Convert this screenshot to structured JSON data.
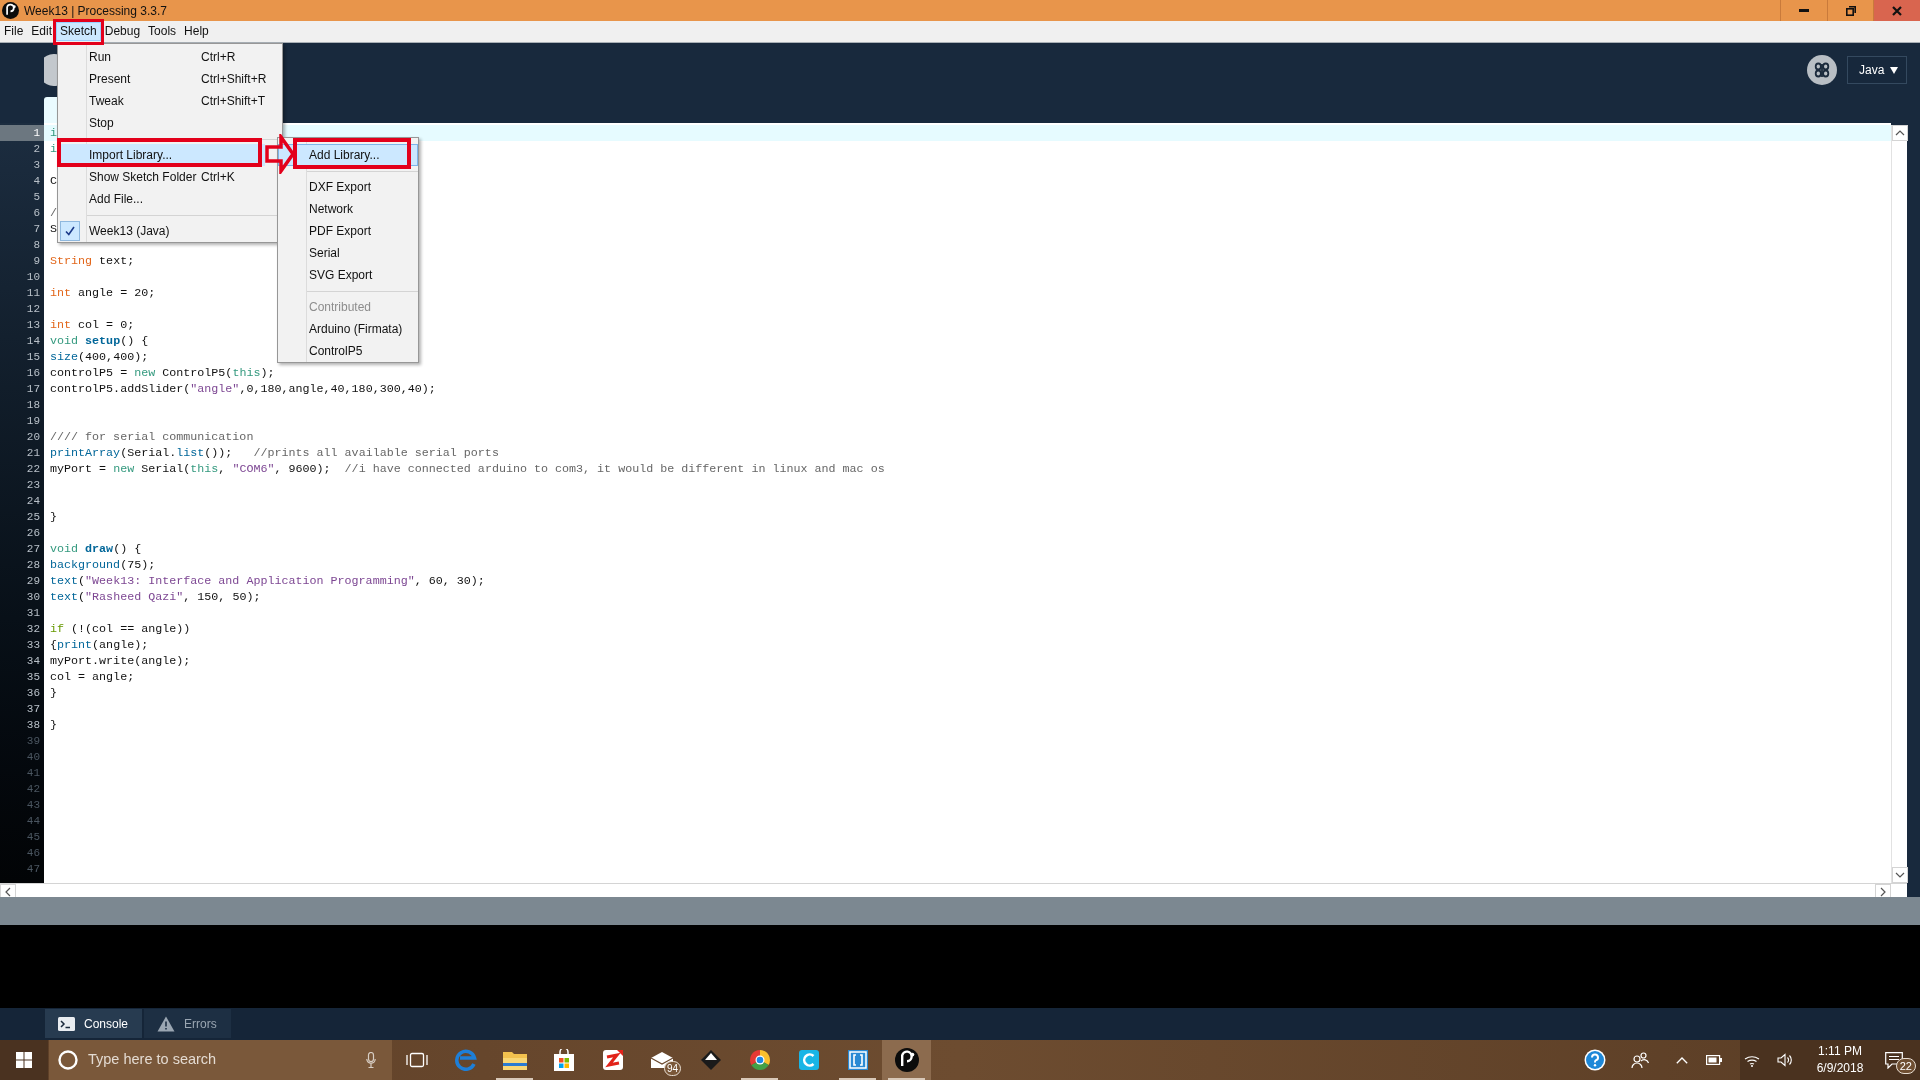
{
  "window": {
    "title": "Week13 | Processing 3.3.7"
  },
  "menu_bar": [
    {
      "label": "File",
      "selected": false,
      "marked": false
    },
    {
      "label": "Edit",
      "selected": false,
      "marked": false
    },
    {
      "label": "Sketch",
      "selected": true,
      "marked": true
    },
    {
      "label": "Debug",
      "selected": false,
      "marked": false
    },
    {
      "label": "Tools",
      "selected": false,
      "marked": false
    },
    {
      "label": "Help",
      "selected": false,
      "marked": false
    }
  ],
  "sketch_menu": [
    {
      "kind": "item",
      "label": "Run",
      "shortcut": "Ctrl+R",
      "selected": false,
      "checked": false,
      "marked": false
    },
    {
      "kind": "item",
      "label": "Present",
      "shortcut": "Ctrl+Shift+R",
      "selected": false,
      "checked": false,
      "marked": false
    },
    {
      "kind": "item",
      "label": "Tweak",
      "shortcut": "Ctrl+Shift+T",
      "selected": false,
      "checked": false,
      "marked": false
    },
    {
      "kind": "item",
      "label": "Stop",
      "selected": false,
      "checked": false,
      "marked": false
    },
    {
      "kind": "separator"
    },
    {
      "kind": "item",
      "label": "Import Library...",
      "selected": true,
      "checked": false,
      "marked": true,
      "submenu": [
        {
          "kind": "item",
          "label": "Add Library...",
          "selected": true,
          "disabled": false,
          "marked": true
        },
        {
          "kind": "separator"
        },
        {
          "kind": "item",
          "label": "DXF Export",
          "selected": false,
          "disabled": false,
          "marked": false
        },
        {
          "kind": "item",
          "label": "Network",
          "selected": false,
          "disabled": false,
          "marked": false
        },
        {
          "kind": "item",
          "label": "PDF Export",
          "selected": false,
          "disabled": false,
          "marked": false
        },
        {
          "kind": "item",
          "label": "Serial",
          "selected": false,
          "disabled": false,
          "marked": false
        },
        {
          "kind": "item",
          "label": "SVG Export",
          "selected": false,
          "disabled": false,
          "marked": false
        },
        {
          "kind": "separator"
        },
        {
          "kind": "item",
          "label": "Contributed",
          "selected": false,
          "disabled": true,
          "marked": false
        },
        {
          "kind": "item",
          "label": "Arduino (Firmata)",
          "selected": false,
          "disabled": false,
          "marked": false
        },
        {
          "kind": "item",
          "label": "ControlP5",
          "selected": false,
          "disabled": false,
          "marked": false
        }
      ]
    },
    {
      "kind": "item",
      "label": "Show Sketch Folder",
      "shortcut": "Ctrl+K",
      "selected": false,
      "checked": false,
      "marked": false
    },
    {
      "kind": "item",
      "label": "Add File...",
      "selected": false,
      "checked": false,
      "marked": false
    },
    {
      "kind": "separator"
    },
    {
      "kind": "item",
      "label": "Week13 (Java)",
      "selected": false,
      "checked": true,
      "marked": false
    }
  ],
  "toolbar": {
    "mode": "Java"
  },
  "editor": {
    "lines": [
      {
        "number": "1",
        "current": true,
        "past_end": false,
        "tokens": [
          {
            "text": "i",
            "kind": "keyword"
          }
        ]
      },
      {
        "number": "2",
        "current": false,
        "past_end": false,
        "tokens": [
          {
            "text": "i",
            "kind": "keyword"
          }
        ]
      },
      {
        "number": "3",
        "current": false,
        "past_end": false
      },
      {
        "number": "4",
        "current": false,
        "past_end": false,
        "tokens": [
          {
            "text": "C",
            "kind": "plain"
          }
        ]
      },
      {
        "number": "5",
        "current": false,
        "past_end": false
      },
      {
        "number": "6",
        "current": false,
        "past_end": false,
        "tokens": [
          {
            "text": "/",
            "kind": "comment"
          }
        ]
      },
      {
        "number": "7",
        "current": false,
        "past_end": false,
        "tokens": [
          {
            "text": "S",
            "kind": "plain"
          }
        ]
      },
      {
        "number": "8",
        "current": false,
        "past_end": false
      },
      {
        "number": "9",
        "current": false,
        "past_end": false,
        "tokens": [
          {
            "text": "String",
            "kind": "type"
          },
          {
            "text": " text;",
            "kind": "plain"
          }
        ]
      },
      {
        "number": "10",
        "current": false,
        "past_end": false
      },
      {
        "number": "11",
        "current": false,
        "past_end": false,
        "tokens": [
          {
            "text": "int",
            "kind": "type"
          },
          {
            "text": " angle = 20;",
            "kind": "plain"
          }
        ]
      },
      {
        "number": "12",
        "current": false,
        "past_end": false
      },
      {
        "number": "13",
        "current": false,
        "past_end": false,
        "tokens": [
          {
            "text": "int",
            "kind": "type"
          },
          {
            "text": " col = 0;",
            "kind": "plain"
          }
        ]
      },
      {
        "number": "14",
        "current": false,
        "past_end": false,
        "tokens": [
          {
            "text": "void ",
            "kind": "keyword"
          },
          {
            "text": "setup",
            "kind": "definition"
          },
          {
            "text": "() {",
            "kind": "plain"
          }
        ]
      },
      {
        "number": "15",
        "current": false,
        "past_end": false,
        "tokens": [
          {
            "text": "size",
            "kind": "function"
          },
          {
            "text": "(400,400);",
            "kind": "plain"
          }
        ]
      },
      {
        "number": "16",
        "current": false,
        "past_end": false,
        "tokens": [
          {
            "text": "controlP5 = ",
            "kind": "plain"
          },
          {
            "text": "new",
            "kind": "keyword"
          },
          {
            "text": " ControlP5(",
            "kind": "plain"
          },
          {
            "text": "this",
            "kind": "keyword"
          },
          {
            "text": ");",
            "kind": "plain"
          }
        ]
      },
      {
        "number": "17",
        "current": false,
        "past_end": false,
        "tokens": [
          {
            "text": "controlP5.addSlider(",
            "kind": "plain"
          },
          {
            "text": "\"angle\"",
            "kind": "string"
          },
          {
            "text": ",0,180,angle,40,180,300,40);",
            "kind": "plain"
          }
        ]
      },
      {
        "number": "18",
        "current": false,
        "past_end": false
      },
      {
        "number": "19",
        "current": false,
        "past_end": false
      },
      {
        "number": "20",
        "current": false,
        "past_end": false,
        "tokens": [
          {
            "text": "//// for serial communication",
            "kind": "comment"
          }
        ]
      },
      {
        "number": "21",
        "current": false,
        "past_end": false,
        "tokens": [
          {
            "text": "printArray",
            "kind": "function"
          },
          {
            "text": "(Serial.",
            "kind": "plain"
          },
          {
            "text": "list",
            "kind": "function"
          },
          {
            "text": "());   ",
            "kind": "plain"
          },
          {
            "text": "//prints all available serial ports",
            "kind": "comment"
          }
        ]
      },
      {
        "number": "22",
        "current": false,
        "past_end": false,
        "tokens": [
          {
            "text": "myPort = ",
            "kind": "plain"
          },
          {
            "text": "new",
            "kind": "keyword"
          },
          {
            "text": " Serial(",
            "kind": "plain"
          },
          {
            "text": "this",
            "kind": "keyword"
          },
          {
            "text": ", ",
            "kind": "plain"
          },
          {
            "text": "\"COM6\"",
            "kind": "string"
          },
          {
            "text": ", 9600);  ",
            "kind": "plain"
          },
          {
            "text": "//i have connected arduino to com3, it would be different in linux and mac os",
            "kind": "comment"
          }
        ]
      },
      {
        "number": "23",
        "current": false,
        "past_end": false
      },
      {
        "number": "24",
        "current": false,
        "past_end": false
      },
      {
        "number": "25",
        "current": false,
        "past_end": false,
        "tokens": [
          {
            "text": "}",
            "kind": "plain"
          }
        ]
      },
      {
        "number": "26",
        "current": false,
        "past_end": false
      },
      {
        "number": "27",
        "current": false,
        "past_end": false,
        "tokens": [
          {
            "text": "void ",
            "kind": "keyword"
          },
          {
            "text": "draw",
            "kind": "definition"
          },
          {
            "text": "() {",
            "kind": "plain"
          }
        ]
      },
      {
        "number": "28",
        "current": false,
        "past_end": false,
        "tokens": [
          {
            "text": "background",
            "kind": "function"
          },
          {
            "text": "(75);",
            "kind": "plain"
          }
        ]
      },
      {
        "number": "29",
        "current": false,
        "past_end": false,
        "tokens": [
          {
            "text": "text",
            "kind": "function"
          },
          {
            "text": "(",
            "kind": "plain"
          },
          {
            "text": "\"Week13: Interface and Application Programming\"",
            "kind": "string"
          },
          {
            "text": ", 60, 30);",
            "kind": "plain"
          }
        ]
      },
      {
        "number": "30",
        "current": false,
        "past_end": false,
        "tokens": [
          {
            "text": "text",
            "kind": "function"
          },
          {
            "text": "(",
            "kind": "plain"
          },
          {
            "text": "\"Rasheed Qazi\"",
            "kind": "string"
          },
          {
            "text": ", 150, 50);",
            "kind": "plain"
          }
        ]
      },
      {
        "number": "31",
        "current": false,
        "past_end": false
      },
      {
        "number": "32",
        "current": false,
        "past_end": false,
        "tokens": [
          {
            "text": "if",
            "kind": "control"
          },
          {
            "text": " (!(col == angle))",
            "kind": "plain"
          }
        ]
      },
      {
        "number": "33",
        "current": false,
        "past_end": false,
        "tokens": [
          {
            "text": "{",
            "kind": "plain"
          },
          {
            "text": "print",
            "kind": "function"
          },
          {
            "text": "(angle);",
            "kind": "plain"
          }
        ]
      },
      {
        "number": "34",
        "current": false,
        "past_end": false,
        "tokens": [
          {
            "text": "myPort.write(angle);",
            "kind": "plain"
          }
        ]
      },
      {
        "number": "35",
        "current": false,
        "past_end": false,
        "tokens": [
          {
            "text": "col = angle;",
            "kind": "plain"
          }
        ]
      },
      {
        "number": "36",
        "current": false,
        "past_end": false,
        "tokens": [
          {
            "text": "}",
            "kind": "plain"
          }
        ]
      },
      {
        "number": "37",
        "current": false,
        "past_end": false
      },
      {
        "number": "38",
        "current": false,
        "past_end": false,
        "tokens": [
          {
            "text": "}",
            "kind": "plain"
          }
        ]
      },
      {
        "number": "39",
        "current": false,
        "past_end": true
      },
      {
        "number": "40",
        "current": false,
        "past_end": true
      },
      {
        "number": "41",
        "current": false,
        "past_end": true
      },
      {
        "number": "42",
        "current": false,
        "past_end": true
      },
      {
        "number": "43",
        "current": false,
        "past_end": true
      },
      {
        "number": "44",
        "current": false,
        "past_end": true
      },
      {
        "number": "45",
        "current": false,
        "past_end": true
      },
      {
        "number": "46",
        "current": false,
        "past_end": true
      },
      {
        "number": "47",
        "current": false,
        "past_end": true
      }
    ]
  },
  "console_tabs": [
    {
      "label": "Console",
      "selected": true
    },
    {
      "label": "Errors",
      "selected": false
    }
  ],
  "taskbar": {
    "search": {
      "placeholder": "Type here to search"
    },
    "apps": [
      {
        "kind": "taskview",
        "running": false,
        "selected": false
      },
      {
        "kind": "browser",
        "running": false,
        "selected": false
      },
      {
        "kind": "folder",
        "running": true,
        "selected": false
      },
      {
        "kind": "store",
        "running": false,
        "selected": false
      },
      {
        "kind": "reader",
        "running": false,
        "selected": false
      },
      {
        "kind": "mail",
        "running": false,
        "selected": false,
        "badge": "94"
      },
      {
        "kind": "pen",
        "running": false,
        "selected": false
      },
      {
        "kind": "wheel",
        "running": true,
        "selected": false
      },
      {
        "kind": "cloud",
        "running": false,
        "selected": false
      },
      {
        "kind": "bracket",
        "running": true,
        "selected": false
      },
      {
        "kind": "sketch",
        "running": true,
        "selected": true
      }
    ],
    "clock": {
      "time": "1:11 PM",
      "date": "6/9/2018"
    },
    "notifications": {
      "badge": "22"
    }
  }
}
